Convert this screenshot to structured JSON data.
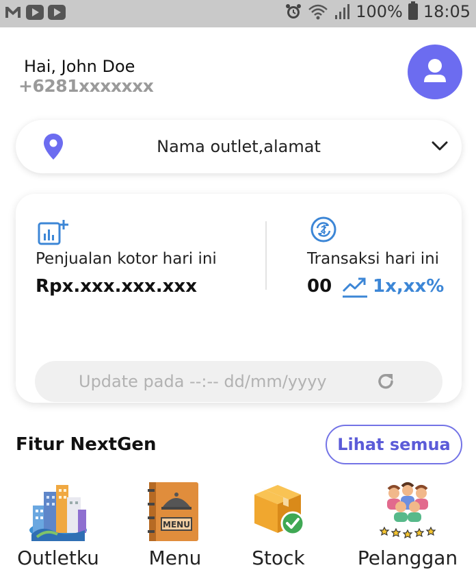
{
  "status_bar": {
    "battery": "100%",
    "time": "18:05"
  },
  "header": {
    "greeting": "Hai, John Doe",
    "phone": "+6281xxxxxxx"
  },
  "outlet": {
    "label": "Nama outlet,alamat"
  },
  "stats": {
    "gross_sales_label": "Penjualan kotor hari ini",
    "gross_sales_value": "Rpx.xxx.xxx.xxx",
    "transactions_label": "Transaksi hari ini",
    "transactions_value": "00",
    "transactions_change": "1x,xx%",
    "update_text": "Update pada --:-- dd/mm/yyyy"
  },
  "features": {
    "title": "Fitur NextGen",
    "see_all": "Lihat semua",
    "items": [
      {
        "label": "Outletku",
        "icon": "city-buildings-icon"
      },
      {
        "label": "Menu",
        "icon": "menu-book-icon"
      },
      {
        "label": "Stock",
        "icon": "stock-box-icon"
      },
      {
        "label": "Pelanggan",
        "icon": "customers-icon"
      }
    ]
  },
  "colors": {
    "accent": "#6c6cf0",
    "accent_text": "#5b5bd8",
    "stat_icon": "#3c86d6",
    "status_bar": "#c9c9c9"
  }
}
